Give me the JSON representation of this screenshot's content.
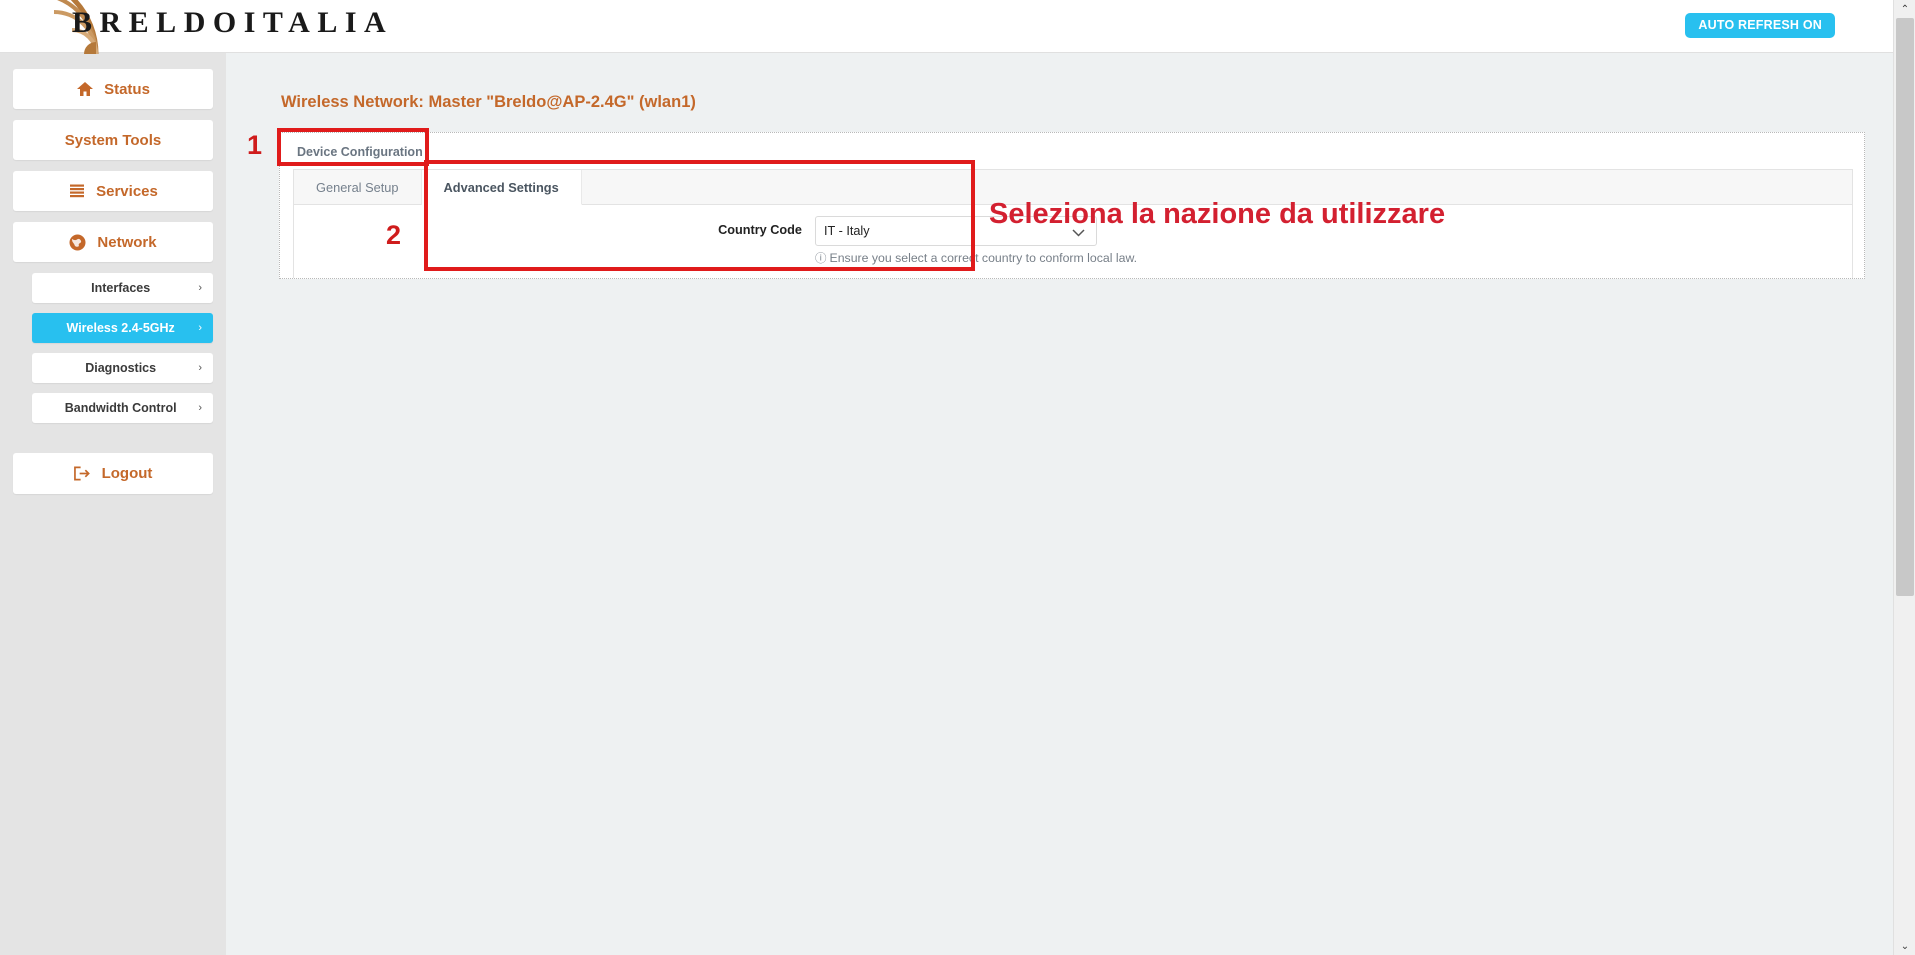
{
  "header": {
    "logo_text": "BRELDOITALIA",
    "logo_icon": "wifi-arcs-logo",
    "auto_refresh_label": "AUTO REFRESH ON"
  },
  "sidebar": {
    "main_items": [
      {
        "label": "Status",
        "icon": "home-icon"
      },
      {
        "label": "System Tools",
        "icon": "none"
      },
      {
        "label": "Services",
        "icon": "list-bars-icon"
      },
      {
        "label": "Network",
        "icon": "globe-icon"
      }
    ],
    "sub_items": [
      {
        "label": "Interfaces",
        "chevron": "›",
        "active": false
      },
      {
        "label": "Wireless 2.4-5GHz",
        "chevron": "›",
        "active": true
      },
      {
        "label": "Diagnostics",
        "chevron": "›",
        "active": false
      },
      {
        "label": "Bandwidth Control",
        "chevron": "›",
        "active": false
      }
    ],
    "logout": {
      "label": "Logout",
      "icon": "logout-arrow-icon"
    }
  },
  "main": {
    "page_title": "Wireless Network: Master \"Breldo@AP-2.4G\" (wlan1)",
    "panel_tab": "Device Configuration",
    "subtabs": [
      {
        "label": "General Setup",
        "active": false
      },
      {
        "label": "Advanced Settings",
        "active": true
      }
    ],
    "country_code": {
      "label": "Country Code",
      "value": "IT - Italy",
      "options": [
        "IT - Italy"
      ],
      "chevron_icon": "chevron-down-icon",
      "help_icon": "info-circle-icon",
      "help_text": "Ensure you select a correct country to conform local law."
    }
  },
  "annotations": {
    "step_1": "1",
    "step_2": "2",
    "callout": "Seleziona la nazione da utilizzare"
  },
  "scrollbar": {
    "up_arrow": "⌃",
    "down_arrow": "⌄"
  },
  "colors": {
    "accent_orange": "#c4682a",
    "accent_cyan": "#28c0ef",
    "annotation_red": "#d32030",
    "sidebar_bg": "#e4e4e4",
    "main_bg": "#eef1f2"
  }
}
